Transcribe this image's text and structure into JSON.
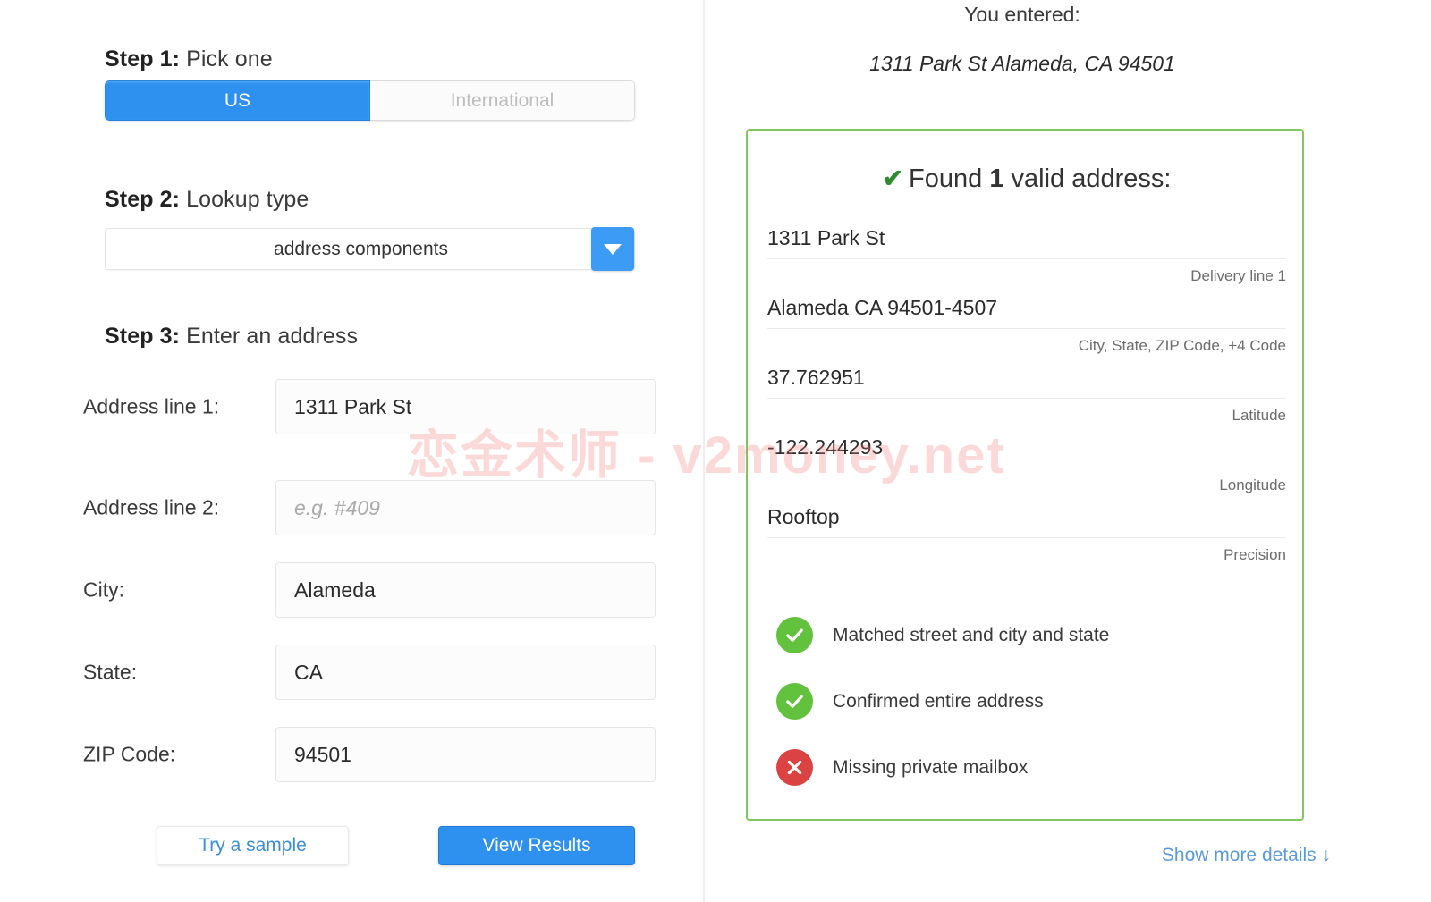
{
  "left": {
    "step1": {
      "num": "Step 1:",
      "text": " Pick one"
    },
    "toggle": {
      "us_label": "US",
      "international_label": "International",
      "active": "US"
    },
    "step2": {
      "num": "Step 2:",
      "text": " Lookup type"
    },
    "lookup_select": {
      "value": "address components",
      "arrow_icon": "chevron-down-icon"
    },
    "step3": {
      "num": "Step 3:",
      "text": " Enter an address"
    },
    "fields": [
      {
        "label": "Address line 1:",
        "value": "1311 Park St",
        "placeholder": "",
        "is_placeholder": false,
        "name": "address-line-1"
      },
      {
        "label": "Address line 2:",
        "value": "e.g. #409",
        "placeholder": "e.g. #409",
        "is_placeholder": true,
        "name": "address-line-2"
      },
      {
        "label": "City:",
        "value": "Alameda",
        "placeholder": "",
        "is_placeholder": false,
        "name": "city"
      },
      {
        "label": "State:",
        "value": "CA",
        "placeholder": "",
        "is_placeholder": false,
        "name": "state"
      },
      {
        "label": "ZIP Code:",
        "value": "94501",
        "placeholder": "",
        "is_placeholder": false,
        "name": "zip-code"
      }
    ],
    "buttons": {
      "try_sample": "Try a sample",
      "view_results": "View Results"
    }
  },
  "right": {
    "entered_label": "You entered:",
    "entered_value": "1311 Park St Alameda, CA 94501",
    "found": {
      "check_icon": "check-icon",
      "prefix": "Found ",
      "count": "1",
      "suffix": " valid address:"
    },
    "rows": [
      {
        "value": "1311 Park St",
        "label": "Delivery line 1"
      },
      {
        "value": "Alameda CA 94501-4507",
        "label": "City, State, ZIP Code, +4 Code"
      },
      {
        "value": "37.762951",
        "label": "Latitude"
      },
      {
        "value": "-122.244293",
        "label": "Longitude"
      },
      {
        "value": "Rooftop",
        "label": "Precision"
      }
    ],
    "badges": [
      {
        "status": "ok",
        "icon": "check-circle-icon",
        "text": "Matched street and city and state"
      },
      {
        "status": "ok",
        "icon": "check-circle-icon",
        "text": "Confirmed entire address"
      },
      {
        "status": "bad",
        "icon": "x-circle-icon",
        "text": "Missing private mailbox"
      }
    ],
    "show_more": "Show more details ↓"
  },
  "watermark": {
    "text": "恋金术师 - v2money.net"
  },
  "colors": {
    "accent_blue": "#2e90ef",
    "border_green": "#80c85a",
    "badge_green": "#62c13d",
    "badge_red": "#db4242",
    "link_blue": "#5a9bd8"
  }
}
